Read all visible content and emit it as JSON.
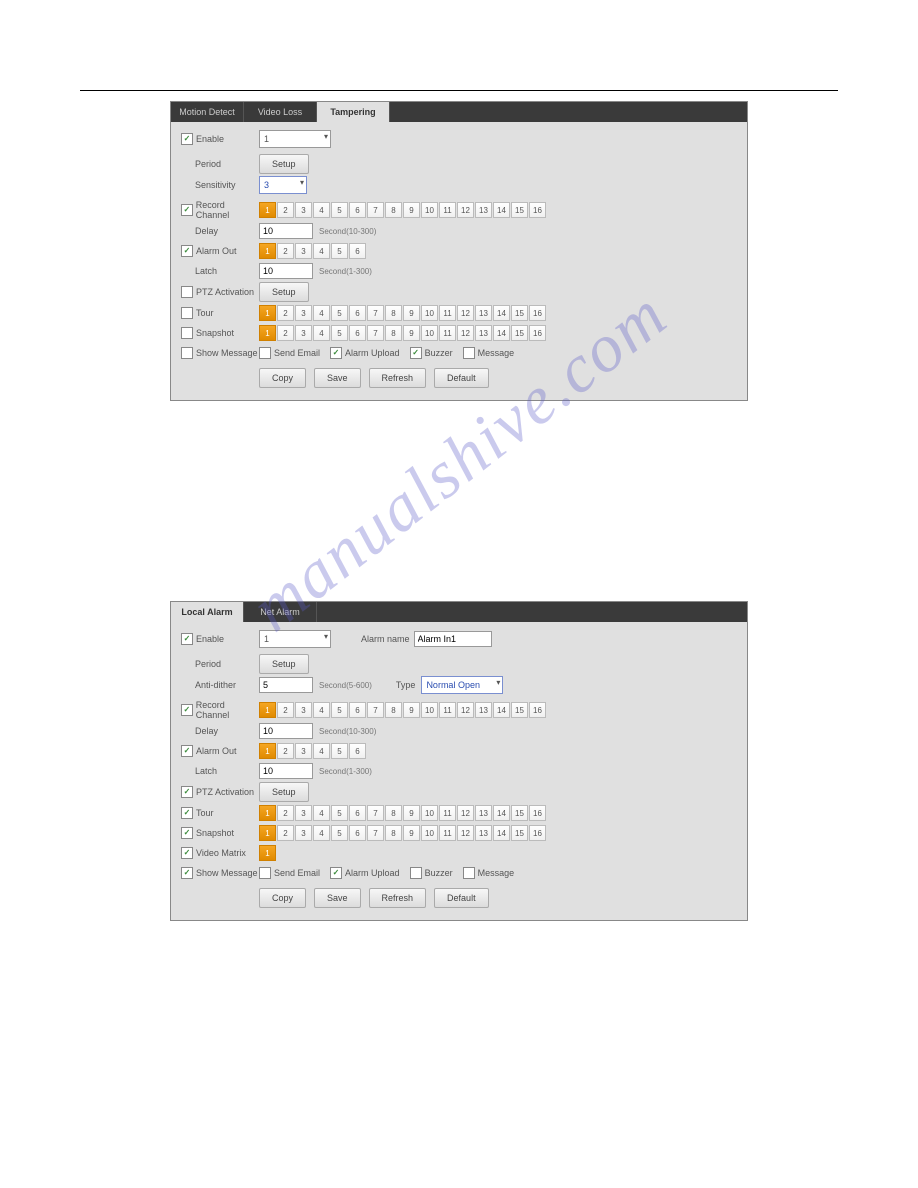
{
  "watermark": "manualshive.com",
  "p1": {
    "tabs": [
      "Motion Detect",
      "Video Loss",
      "Tampering"
    ],
    "active": 2,
    "enable": "Enable",
    "channel_sel": "1",
    "period": "Period",
    "setup": "Setup",
    "sensitivity": "Sensitivity",
    "sens_val": "3",
    "record_channel": "Record Channel",
    "delay": "Delay",
    "delay_val": "10",
    "delay_hint": "Second(10-300)",
    "alarm_out": "Alarm Out",
    "latch": "Latch",
    "latch_val": "10",
    "latch_hint": "Second(1-300)",
    "ptz": "PTZ Activation",
    "tour": "Tour",
    "snapshot": "Snapshot",
    "show_msg": "Show Message",
    "send_email": "Send Email",
    "alarm_upload": "Alarm Upload",
    "buzzer": "Buzzer",
    "message": "Message",
    "copy": "Copy",
    "save": "Save",
    "refresh": "Refresh",
    "default": "Default",
    "record_sel": [
      1
    ],
    "alarm_sel": [
      1
    ],
    "tour_sel": [
      1
    ],
    "snap_sel": [
      1
    ],
    "alarm_count": 6,
    "full_count": 16
  },
  "p2": {
    "tabs": [
      "Local Alarm",
      "Net Alarm"
    ],
    "active": 0,
    "enable": "Enable",
    "channel_sel": "1",
    "alarm_name": "Alarm name",
    "alarm_name_val": "Alarm In1",
    "period": "Period",
    "setup": "Setup",
    "antidither": "Anti-dither",
    "anti_val": "5",
    "anti_hint": "Second(5-600)",
    "type": "Type",
    "type_val": "Normal Open",
    "record_channel": "Record Channel",
    "delay": "Delay",
    "delay_val": "10",
    "delay_hint": "Second(10-300)",
    "alarm_out": "Alarm Out",
    "latch": "Latch",
    "latch_val": "10",
    "latch_hint": "Second(1-300)",
    "ptz": "PTZ Activation",
    "tour": "Tour",
    "snapshot": "Snapshot",
    "video_matrix": "Video Matrix",
    "show_msg": "Show Message",
    "send_email": "Send Email",
    "alarm_upload": "Alarm Upload",
    "buzzer": "Buzzer",
    "message": "Message",
    "copy": "Copy",
    "save": "Save",
    "refresh": "Refresh",
    "default": "Default",
    "record_sel": [
      1
    ],
    "alarm_sel": [
      1
    ],
    "tour_sel": [
      1
    ],
    "snap_sel": [
      1
    ],
    "vm_sel": [
      1
    ],
    "alarm_count": 6,
    "full_count": 16,
    "vm_count": 1
  }
}
